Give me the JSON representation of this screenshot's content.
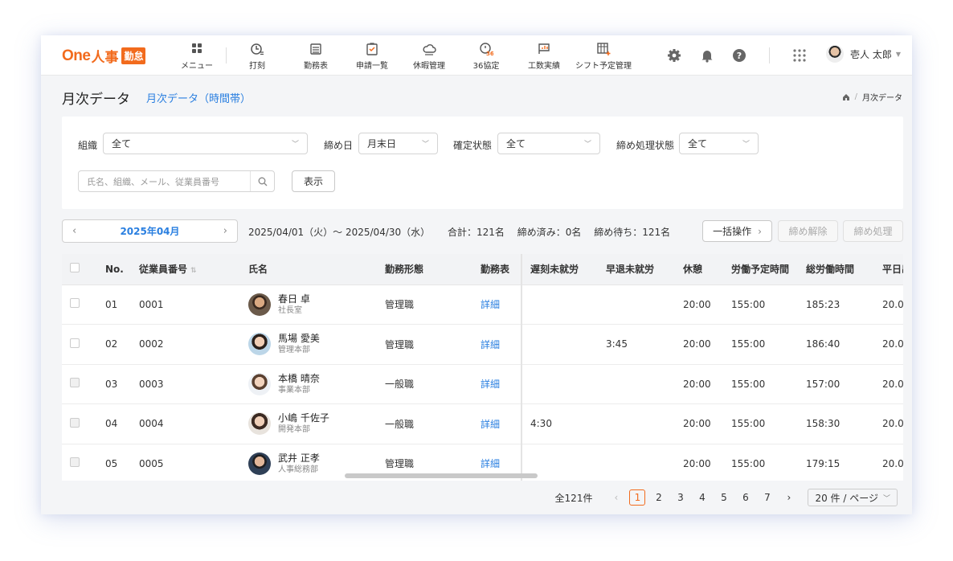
{
  "brand": {
    "one": "One",
    "jinji": "人事",
    "kintai": "勤怠"
  },
  "nav": [
    {
      "label": "メニュー",
      "icon": "grid-icon"
    },
    {
      "label": "打刻",
      "icon": "clock-icon"
    },
    {
      "label": "勤務表",
      "icon": "timesheet-icon"
    },
    {
      "label": "申請一覧",
      "icon": "application-icon"
    },
    {
      "label": "休暇管理",
      "icon": "cloud-icon"
    },
    {
      "label": "36協定",
      "icon": "agreement36-icon"
    },
    {
      "label": "工数実績",
      "icon": "chart-flag-icon"
    },
    {
      "label": "シフト予定管理",
      "icon": "shift-calendar-icon"
    }
  ],
  "user": {
    "name": "壱人 太郎"
  },
  "page": {
    "title": "月次データ",
    "subtitle": "月次データ（時間帯）"
  },
  "breadcrumb": {
    "current": "月次データ"
  },
  "filters": {
    "org_label": "組織",
    "org_value": "全て",
    "closing_label": "締め日",
    "closing_value": "月末日",
    "confirm_label": "確定状態",
    "confirm_value": "全て",
    "process_label": "締め処理状態",
    "process_value": "全て",
    "search_placeholder": "氏名、組織、メール、従業員番号",
    "show_button": "表示"
  },
  "period": {
    "month": "2025年04月",
    "range": "2025/04/01（火）〜 2025/04/30（水）",
    "total": "合計：121名",
    "closed": "締め済み：0名",
    "pending": "締め待ち：121名"
  },
  "actions": {
    "bulk": "一括操作",
    "unlock": "締め解除",
    "close": "締め処理"
  },
  "table": {
    "headers": [
      "No.",
      "従業員番号",
      "氏名",
      "勤務形態",
      "勤務表",
      "遅刻未就労",
      "早退未就労",
      "休憩",
      "労働予定時間",
      "総労働時間",
      "平日出"
    ],
    "rows": [
      {
        "no": "01",
        "emp": "0001",
        "name": "春日 卓",
        "dept": "社長室",
        "type": "管理職",
        "sheet": "詳細",
        "late": "",
        "early": "",
        "break": "20:00",
        "planned": "155:00",
        "total": "185:23",
        "weekday": "20.0"
      },
      {
        "no": "02",
        "emp": "0002",
        "name": "馬場 愛美",
        "dept": "管理本部",
        "type": "管理職",
        "sheet": "詳細",
        "late": "",
        "early": "3:45",
        "break": "20:00",
        "planned": "155:00",
        "total": "186:40",
        "weekday": "20.0"
      },
      {
        "no": "03",
        "emp": "0003",
        "name": "本橋 晴奈",
        "dept": "事業本部",
        "type": "一般職",
        "sheet": "詳細",
        "late": "",
        "early": "",
        "break": "20:00",
        "planned": "155:00",
        "total": "157:00",
        "weekday": "20.0"
      },
      {
        "no": "04",
        "emp": "0004",
        "name": "小嶋 千佐子",
        "dept": "開発本部",
        "type": "一般職",
        "sheet": "詳細",
        "late": "4:30",
        "early": "",
        "break": "20:00",
        "planned": "155:00",
        "total": "158:30",
        "weekday": "20.0"
      },
      {
        "no": "05",
        "emp": "0005",
        "name": "武井 正孝",
        "dept": "人事総務部",
        "type": "管理職",
        "sheet": "詳細",
        "late": "",
        "early": "",
        "break": "20:00",
        "planned": "155:00",
        "total": "179:15",
        "weekday": "20.0"
      }
    ]
  },
  "pagination": {
    "total": "全121件",
    "pages": [
      "1",
      "2",
      "3",
      "4",
      "5",
      "6",
      "7"
    ],
    "current": "1",
    "page_size": "20 件 / ページ"
  },
  "colors": {
    "brand": "#f26b1d",
    "link": "#2a7fe0"
  }
}
